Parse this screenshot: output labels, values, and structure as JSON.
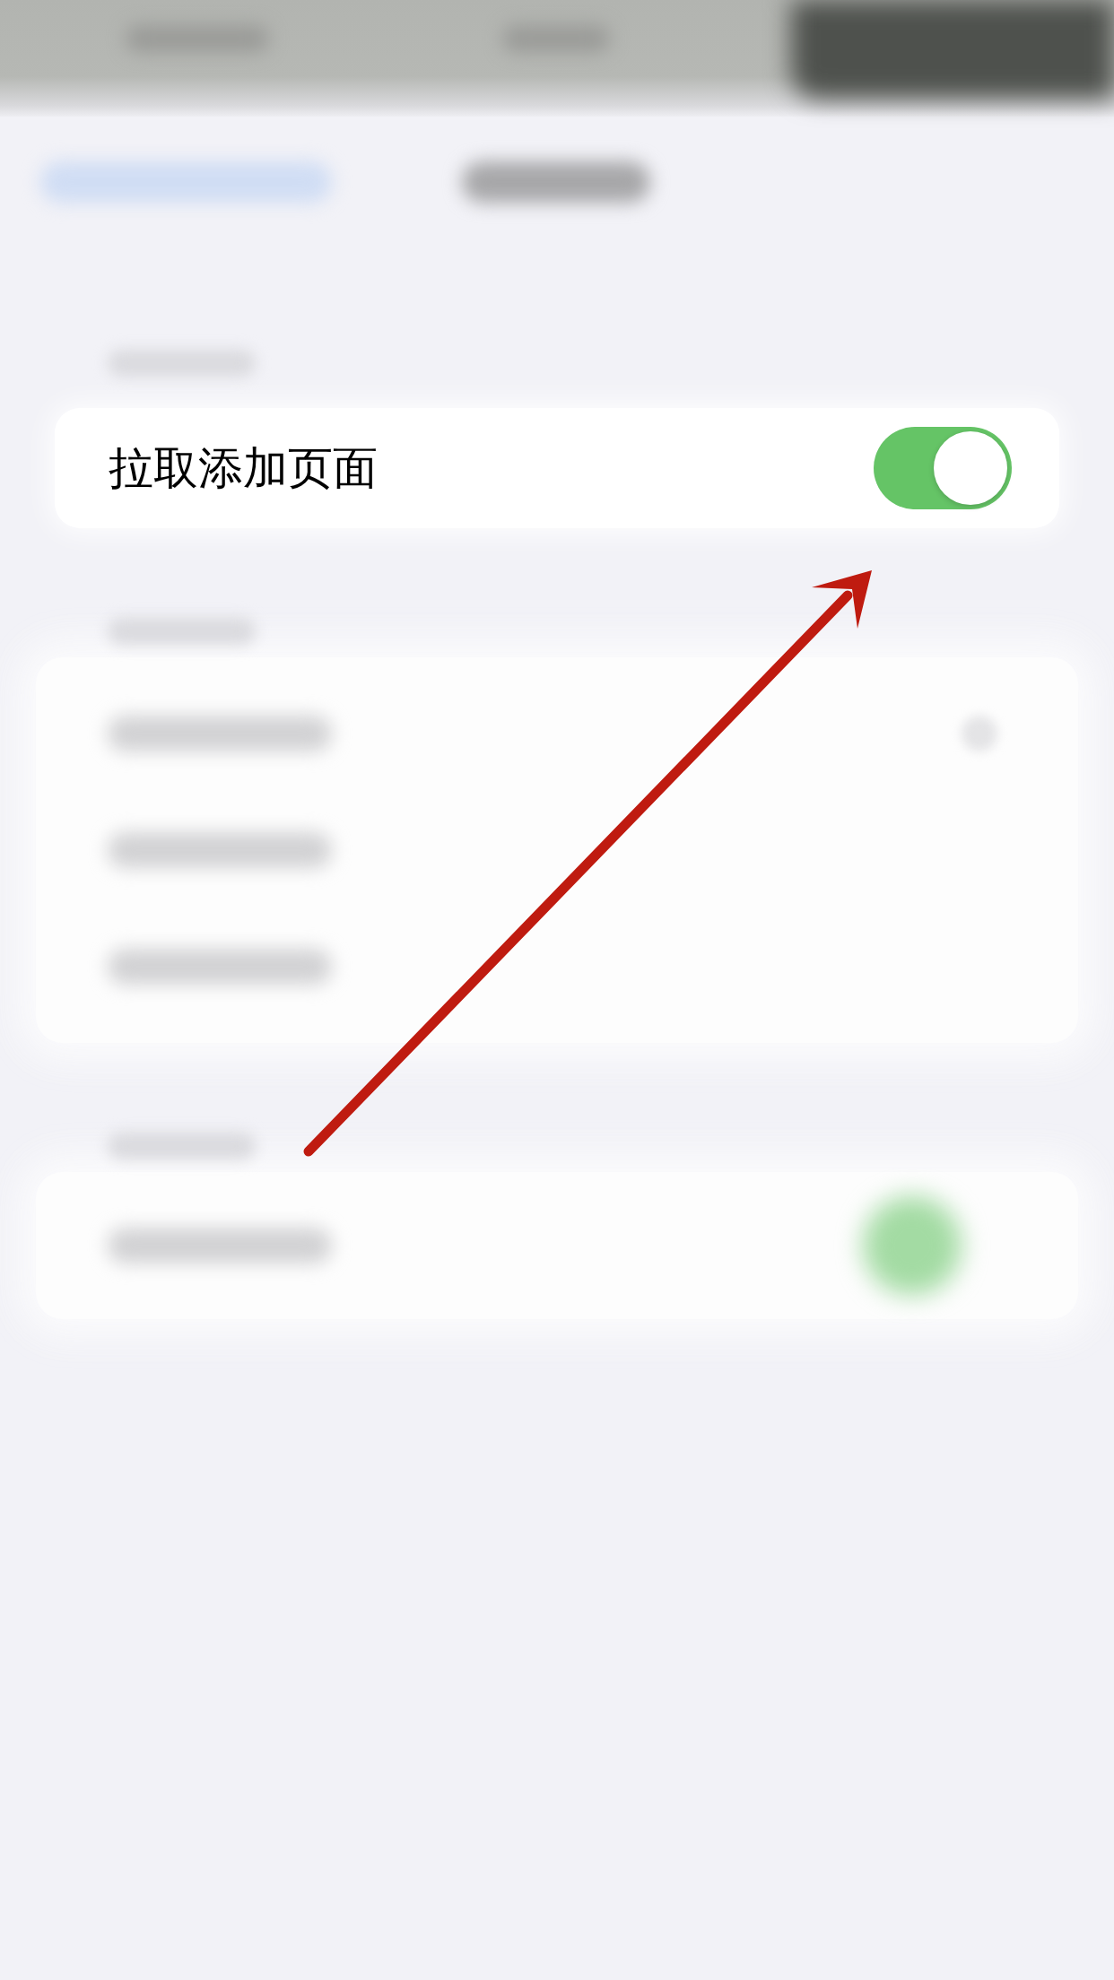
{
  "backdrop": {
    "status_bar": [
      {
        "kind": "text"
      },
      {
        "kind": "text"
      },
      {
        "kind": "dark_patch"
      }
    ],
    "nav_bar": [
      {
        "kind": "back_link"
      },
      {
        "kind": "title"
      }
    ],
    "sections": [
      {
        "header": true,
        "highlighted_row": {
          "label": "拉取添加页面",
          "on": true
        }
      },
      {
        "header": true,
        "rows": [
          {
            "kind": "accessory"
          },
          {
            "kind": "plain"
          },
          {
            "kind": "plain"
          }
        ]
      },
      {
        "header": true,
        "rows": [
          {
            "kind": "switch"
          }
        ]
      }
    ]
  },
  "annotation": {
    "kind": "arrow"
  }
}
